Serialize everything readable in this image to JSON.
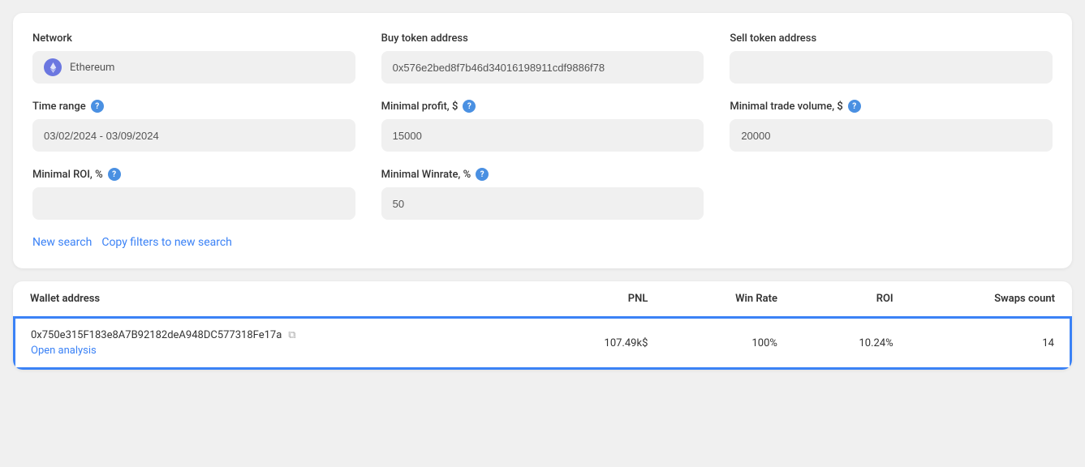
{
  "filters": {
    "network_label": "Network",
    "network_value": "Ethereum",
    "buy_token_label": "Buy token address",
    "buy_token_value": "0x576e2bed8f7b46d34016198911cdf9886f78",
    "sell_token_label": "Sell token address",
    "sell_token_value": "",
    "time_range_label": "Time range",
    "time_range_value": "03/02/2024 - 03/09/2024",
    "minimal_profit_label": "Minimal profit, $",
    "minimal_profit_value": "15000",
    "minimal_trade_label": "Minimal trade volume, $",
    "minimal_trade_value": "20000",
    "minimal_roi_label": "Minimal ROI, %",
    "minimal_roi_value": "",
    "minimal_winrate_label": "Minimal Winrate, %",
    "minimal_winrate_value": "50",
    "new_search_link": "New search",
    "copy_filters_link": "Copy filters to new search"
  },
  "table": {
    "columns": {
      "wallet": "Wallet address",
      "pnl": "PNL",
      "winrate": "Win Rate",
      "roi": "ROI",
      "swaps": "Swaps count"
    },
    "rows": [
      {
        "wallet_address": "0x750e315F183e8A7B92182deA948DC577318Fe17a",
        "pnl": "107.49k$",
        "win_rate": "100%",
        "roi": "10.24%",
        "swaps": "14",
        "open_analysis_label": "Open analysis",
        "highlighted": true
      }
    ]
  },
  "icons": {
    "copy": "⧉",
    "eth_symbol": "Ξ"
  }
}
